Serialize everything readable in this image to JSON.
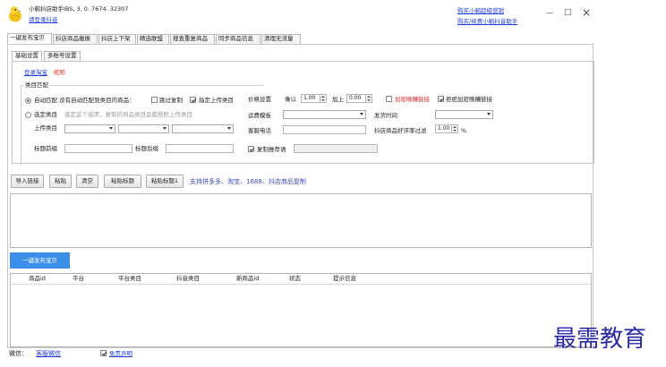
{
  "window": {
    "title": "小鹌抖店助手IBS, 3. 0. 7674. 32307",
    "login_link": "请登录抖音",
    "buy_link": "购买小鹌超级营销",
    "renew_link": "购买/续费小鹌抖音助手",
    "minimize_label": "—",
    "maximize_label": "□",
    "close_label": "×"
  },
  "tabs": [
    {
      "label": "一键发布宝贝"
    },
    {
      "label": "抖店商品搬换"
    },
    {
      "label": "抖店上下架"
    },
    {
      "label": "精选联盟"
    },
    {
      "label": "搜查重复商品"
    },
    {
      "label": "同步商品信息"
    },
    {
      "label": "清理无流量"
    }
  ],
  "sub_tabs": [
    {
      "label": "基础设置"
    },
    {
      "label": "多账号设置"
    }
  ],
  "login_taobao": "登录淘宝",
  "nickname_label": "昵称",
  "category": {
    "section_label": "类目匹配",
    "auto_match": "自动匹配 没有自动匹配到类目的商品：",
    "skip_copy": "跳过复制",
    "specify_category": "指定上传类目",
    "choose_category": "选定类目",
    "choose_note": "选定这个选项，复制的商品类目会都按照上传类目",
    "upload_category": "上传类目"
  },
  "title_prefix_label": "标题前缀",
  "title_suffix_label": "标题后缀",
  "price": {
    "label": "价格设置",
    "multiply_label": "乘以",
    "multiply_value": "1.00",
    "add_label": "加上",
    "add_value": "0.00",
    "add_fake_link": "加密晚糟链接",
    "reject_link": "拒绝加密晚糟链接"
  },
  "shipping_template_label": "运费模板",
  "delivery_time_label": "发货时间",
  "service_phone_label": "客服电话",
  "rating_filter_label": "抖店商品好评率过滤",
  "rating_filter_value": "1.00",
  "rating_filter_unit": "%",
  "copy_recommend": "复制推荐语",
  "toolbar": {
    "import_link": "导入链接",
    "paste": "粘贴",
    "clear": "清空",
    "paste_title": "粘贴标题",
    "paste_title2": "粘贴标题1",
    "support_note": "支持拼多多、淘宝、1688、抖店商品复制"
  },
  "publish_button": "一键发布宝贝",
  "table": {
    "columns": [
      "商品id",
      "平台",
      "平台类目",
      "抖音类目",
      "新商品id",
      "状态",
      "提示信息"
    ]
  },
  "footer": {
    "wechat_label": "微信：",
    "wechat_link": "客服微信",
    "disclaimer_label": "免责声明"
  },
  "watermark": "最需教育",
  "colors": {
    "accent_blue": "#3b8fe8",
    "link_blue": "#1f3fd6",
    "warning_red": "#d83030"
  }
}
